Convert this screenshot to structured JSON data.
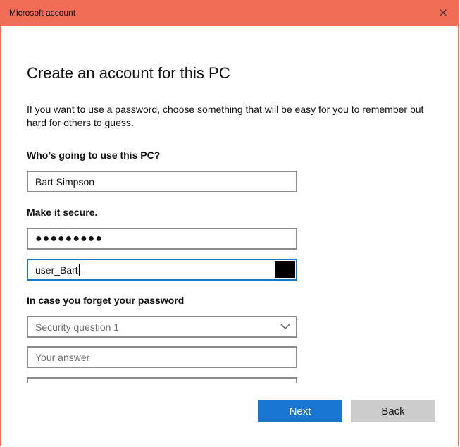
{
  "window": {
    "title": "Microsoft account",
    "accent_color": "#f26d55",
    "close_icon": "close-icon"
  },
  "page": {
    "heading": "Create an account for this PC",
    "description": "If you want to use a password, choose something that will be easy for you to remember but hard for others to guess."
  },
  "user_section": {
    "label": "Who’s going to use this PC?",
    "username_value": "Bart Simpson"
  },
  "secure_section": {
    "label": "Make it secure.",
    "password_masked": "●●●●●●●●●",
    "reenter_value": "user_Bart",
    "reveal_icon": "reveal-password-icon"
  },
  "recovery_section": {
    "label": "In case you forget your password",
    "security_question_placeholder": "Security question 1",
    "answer_placeholder": "Your answer",
    "chevron_icon": "chevron-down-icon"
  },
  "buttons": {
    "next_label": "Next",
    "back_label": "Back",
    "primary_color": "#1a75d2"
  }
}
